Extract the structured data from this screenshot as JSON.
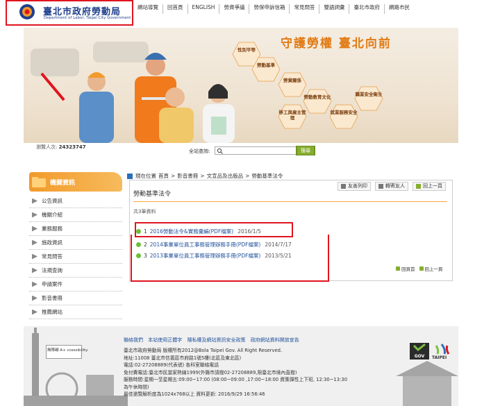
{
  "header": {
    "logo_title": "臺北市政府勞動局",
    "logo_subtitle": "Department of Labor, Taipei City Government",
    "nav": [
      "網站導覽",
      "回首頁",
      "ENGLISH",
      "勞資爭議",
      "勞保申訴信箱",
      "常見問答",
      "雙語詞彙",
      "臺北市政府",
      "網路市民"
    ]
  },
  "banner": {
    "slogan": "守護勞權 臺北向前",
    "hex_labels": [
      "性別平等",
      "勞動基準",
      "勞資關係",
      "勞動教育文化",
      "移工與雇主管理",
      "就業服務安全",
      "職業安全衛生"
    ]
  },
  "visit": {
    "label": "瀏覽人次:",
    "count": "24323747"
  },
  "search": {
    "label": "全站查詢:",
    "placeholder": "",
    "button": "搜尋"
  },
  "sidebar": {
    "title": "機關資訊",
    "items": [
      "公告資訊",
      "機關介紹",
      "業務服務",
      "施政資訊",
      "常見問答",
      "法規查詢",
      "申請案件",
      "影音書冊",
      "推薦網站"
    ]
  },
  "breadcrumb": {
    "current_label": "現在位置",
    "items": [
      "首頁",
      "影音書冊",
      "文宣品及出版品",
      "勞動基準法令"
    ],
    "sep": ">"
  },
  "panel": {
    "title": "勞動基準法令",
    "tools": [
      "友善列印",
      "轉寄友人",
      "回上一頁"
    ],
    "total": "共3筆資料",
    "rows": [
      {
        "no": "1",
        "title": "2016勞動法令&實務彙編(PDF檔案)",
        "date": "2016/1/5"
      },
      {
        "no": "2",
        "title": "2014事業單位員工事務管理辦務手冊(PDF檔案)",
        "date": "2014/7/17"
      },
      {
        "no": "3",
        "title": "2013事業單位員工事務管理辦務手冊(PDF檔案)",
        "date": "2013/5/21"
      }
    ],
    "bottom_links": [
      "回頁首",
      "回上一頁"
    ]
  },
  "footer": {
    "accessibility": "無障礙 A+ ccessibility",
    "links": [
      "聯絡我們",
      "本站使用正體字",
      "隱私權及網站資訊安全政策",
      "政府網站資料開放宣告"
    ],
    "lines": [
      "臺北市政府勞動局 版權所有2012@Bola Taipei Gov. All Right Reserved.",
      "地址:11008 臺北市信義區市府路1號5樓(北區及東北區)",
      "電話:02-27208889(代表號)  各科室聯絡電話",
      "免付費電話:臺北市民當家熱線1999(外縣市請撥02-27208889,限臺北市境內直撥)",
      "服務時間:星期一至星期五:09:00~17:00 (08:00~09:00 ,17:00~18:00 資策彈性上下班, 12:30~13:30",
      "為午休時間)",
      "最佳瀏覽解析度為1024x768以上    資料更新: 2016/9/29 16:56:46"
    ],
    "gov_logo": "GOV",
    "taipei_logo": "TAIPEI"
  },
  "colors": {
    "accent_orange": "#f29a2b",
    "link_blue": "#1f4f9a",
    "highlight_red": "#e0141e",
    "green": "#86ad2e"
  }
}
